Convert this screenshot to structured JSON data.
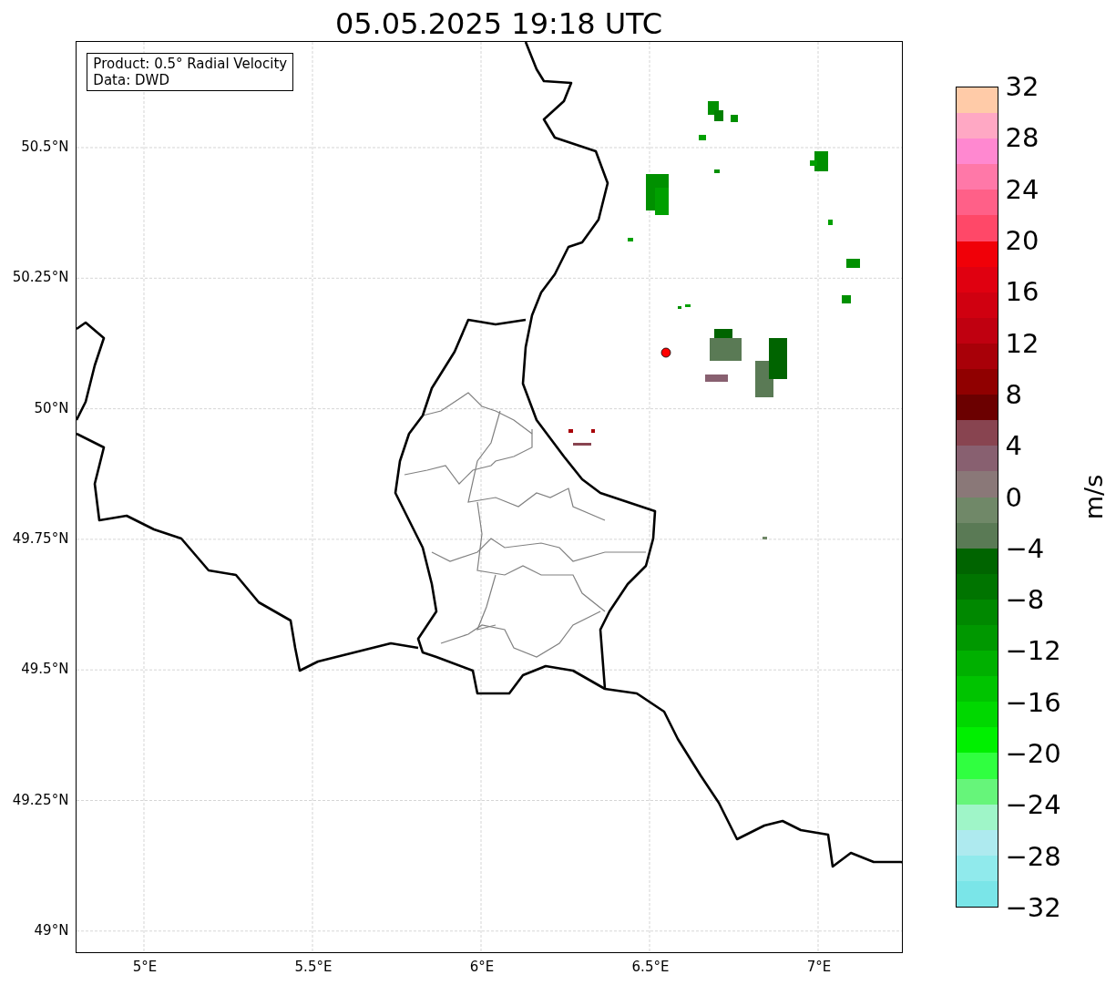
{
  "title": "05.05.2025 19:18 UTC",
  "info_box": [
    "Product: 0.5° Radial Velocity",
    "Data: DWD"
  ],
  "x_ticks": [
    "5°E",
    "5.5°E",
    "6°E",
    "6.5°E",
    "7°E"
  ],
  "y_ticks": [
    "50.5°N",
    "50.25°N",
    "50°N",
    "49.75°N",
    "49.5°N",
    "49.25°N",
    "49°N"
  ],
  "colorbar": {
    "label": "m/s",
    "ticks": [
      "32",
      "28",
      "24",
      "20",
      "16",
      "12",
      "8",
      "4",
      "0",
      "−4",
      "−8",
      "−12",
      "−16",
      "−20",
      "−24",
      "−28",
      "−32"
    ],
    "segments": [
      {
        "color": "#ffcba8"
      },
      {
        "color": "#ffa8c4"
      },
      {
        "color": "#ff88d0"
      },
      {
        "color": "#ff78a8"
      },
      {
        "color": "#ff6088"
      },
      {
        "color": "#ff4868"
      },
      {
        "color": "#f00008"
      },
      {
        "color": "#e00010"
      },
      {
        "color": "#d00010"
      },
      {
        "color": "#c00010"
      },
      {
        "color": "#a80008"
      },
      {
        "color": "#900000"
      },
      {
        "color": "#6b0000"
      },
      {
        "color": "#884450"
      },
      {
        "color": "#886070"
      },
      {
        "color": "#8a7878"
      },
      {
        "color": "#708868"
      },
      {
        "color": "#5a7a55"
      },
      {
        "color": "#006400"
      },
      {
        "color": "#007400"
      },
      {
        "color": "#008800"
      },
      {
        "color": "#009800"
      },
      {
        "color": "#00b000"
      },
      {
        "color": "#00c400"
      },
      {
        "color": "#00d800"
      },
      {
        "color": "#00f000"
      },
      {
        "color": "#30ff40"
      },
      {
        "color": "#66f57a"
      },
      {
        "color": "#9ff5c8"
      },
      {
        "color": "#aeeaef"
      },
      {
        "color": "#90eaec"
      },
      {
        "color": "#7ae5e8"
      }
    ]
  }
}
